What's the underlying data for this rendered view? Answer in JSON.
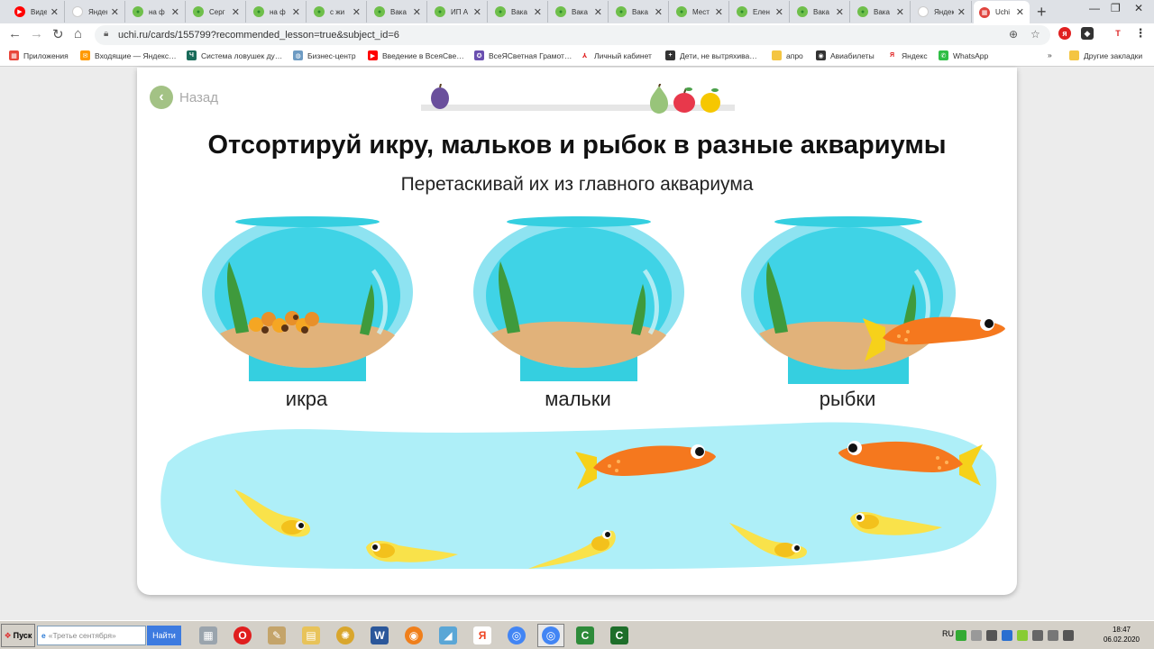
{
  "tabs": [
    {
      "title": "Виде",
      "favicon": "youtube-icon",
      "color": "#ff0000",
      "glyph": "▶"
    },
    {
      "title": "Яндекс",
      "favicon": "yandex-icon",
      "color": "#ffffff",
      "glyph": ""
    },
    {
      "title": "на ф",
      "favicon": "uchi-icon",
      "color": "#6fbf4b",
      "glyph": "●"
    },
    {
      "title": "Серг",
      "favicon": "uchi-icon",
      "color": "#6fbf4b",
      "glyph": "●"
    },
    {
      "title": "на ф",
      "favicon": "uchi-icon",
      "color": "#6fbf4b",
      "glyph": "●"
    },
    {
      "title": "с жи",
      "favicon": "uchi-icon",
      "color": "#6fbf4b",
      "glyph": "●"
    },
    {
      "title": "Вака",
      "favicon": "uchi-icon",
      "color": "#6fbf4b",
      "glyph": "●"
    },
    {
      "title": "ИП А",
      "favicon": "uchi-icon",
      "color": "#6fbf4b",
      "glyph": "●"
    },
    {
      "title": "Вака",
      "favicon": "uchi-icon",
      "color": "#6fbf4b",
      "glyph": "●"
    },
    {
      "title": "Вака",
      "favicon": "uchi-icon",
      "color": "#6fbf4b",
      "glyph": "●"
    },
    {
      "title": "Вака",
      "favicon": "uchi-icon",
      "color": "#6fbf4b",
      "glyph": "●"
    },
    {
      "title": "Мест",
      "favicon": "uchi-icon",
      "color": "#6fbf4b",
      "glyph": "●"
    },
    {
      "title": "Елен",
      "favicon": "uchi-icon",
      "color": "#6fbf4b",
      "glyph": "●"
    },
    {
      "title": "Вака",
      "favicon": "uchi-icon",
      "color": "#6fbf4b",
      "glyph": "●"
    },
    {
      "title": "Вака",
      "favicon": "uchi-icon",
      "color": "#6fbf4b",
      "glyph": "●"
    },
    {
      "title": "Яндекс",
      "favicon": "yandex-icon",
      "color": "#ffffff",
      "glyph": ""
    },
    {
      "title": "Uchi",
      "favicon": "uchi-logo-icon",
      "color": "#e0443e",
      "glyph": "▦",
      "active": true
    }
  ],
  "address_bar": {
    "url": "uchi.ru/cards/155799?recommended_lesson=true&subject_id=6"
  },
  "bookmarks": [
    {
      "label": "Приложения",
      "icon": "apps-grid-icon",
      "color": "#e8473c",
      "glyph": "▦"
    },
    {
      "label": "Входящие — Яндекс…",
      "icon": "mail-icon",
      "color": "#ff9900",
      "glyph": "✉"
    },
    {
      "label": "Система ловушек ду…",
      "icon": "ch-icon",
      "color": "#1a6b5a",
      "glyph": "Ч"
    },
    {
      "label": "Бизнес-центр",
      "icon": "globe-icon",
      "color": "#6d9bc3",
      "glyph": "◍"
    },
    {
      "label": "Введение в ВсеяСве…",
      "icon": "youtube-icon",
      "color": "#ff0000",
      "glyph": "▶"
    },
    {
      "label": "ВсеЯСветная Грамот…",
      "icon": "star-outline-icon",
      "color": "#6a4fb0",
      "glyph": "✪"
    },
    {
      "label": "Личный кабинет",
      "icon": "chart-icon",
      "color": "#ffffff",
      "glyph": "⅄"
    },
    {
      "label": "Дети, не вытряхива…",
      "icon": "plus-icon",
      "color": "#333333",
      "glyph": "+"
    },
    {
      "label": "апро",
      "icon": "folder-icon",
      "color": "#f4c542",
      "glyph": ""
    },
    {
      "label": "Авиабилеты",
      "icon": "globe-dark-icon",
      "color": "#333333",
      "glyph": "◉"
    },
    {
      "label": "Яндекс",
      "icon": "yandex-y-icon",
      "color": "#ffffff",
      "glyph": "Я"
    },
    {
      "label": "WhatsApp",
      "icon": "whatsapp-icon",
      "color": "#2fbe45",
      "glyph": "✆"
    }
  ],
  "other_bookmarks": "Другие закладки",
  "card": {
    "back_label": "Назад",
    "title": "Отсортируй икру, мальков и рыбок в разные аквариумы",
    "subtitle": "Перетаскивай их из главного аквариума",
    "bowls": [
      {
        "label": "икра"
      },
      {
        "label": "мальки"
      },
      {
        "label": "рыбки"
      }
    ]
  },
  "taskbar": {
    "start_label": "Пуск",
    "search_placeholder": "«Третье сентября»",
    "search_button": "Найти",
    "language": "RU",
    "time": "18:47",
    "date": "06.02.2020"
  }
}
